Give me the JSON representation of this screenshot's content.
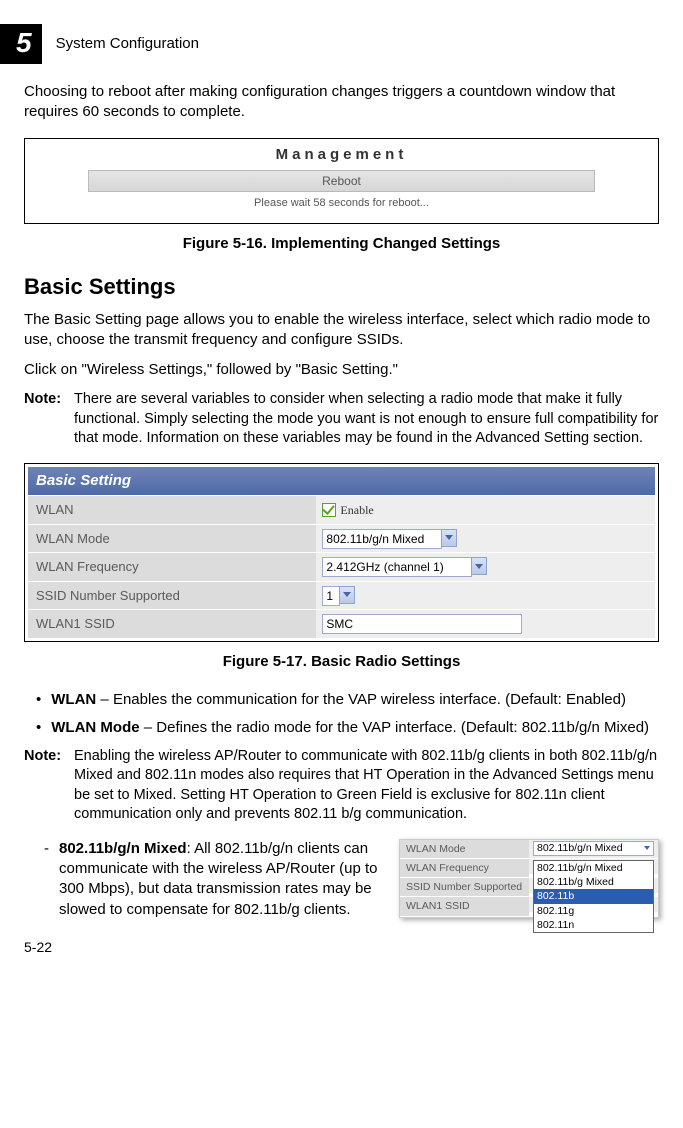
{
  "header": {
    "chapter_number": "5",
    "chapter_title": "System Configuration"
  },
  "para_intro": "Choosing to reboot after making configuration changes triggers a countdown window that requires 60 seconds to complete.",
  "fig516": {
    "management": "Management",
    "reboot": "Reboot",
    "msg": "Please wait 58 seconds for reboot...",
    "caption": "Figure 5-16.   Implementing Changed Settings"
  },
  "h2_basic": "Basic Settings",
  "para_basic1": "The Basic Setting page allows you to enable the wireless interface, select which radio mode to use, choose the transmit frequency and configure SSIDs.",
  "para_basic2": "Click on \"Wireless Settings,\" followed by \"Basic Setting.\"",
  "note1": {
    "label": "Note:",
    "text": "There are several variables to consider when selecting a radio mode that make it fully functional. Simply selecting the mode you want is not enough to ensure full compatibility for that mode. Information on these variables may be found in the Advanced Setting section."
  },
  "fig517": {
    "title": "Basic Setting",
    "rows": {
      "wlan_l": "WLAN",
      "wlan_v": "Enable",
      "mode_l": "WLAN Mode",
      "mode_v": "802.11b/g/n Mixed",
      "freq_l": "WLAN Frequency",
      "freq_v": "2.412GHz (channel 1)",
      "ssidnum_l": "SSID Number Supported",
      "ssidnum_v": "1",
      "ssid_l": "WLAN1 SSID",
      "ssid_v": "SMC"
    },
    "caption": "Figure 5-17.   Basic Radio Settings"
  },
  "bullets": {
    "wlan_term": "WLAN",
    "wlan_text": " – Enables the communication for the VAP wireless interface. (Default: Enabled)",
    "mode_term": "WLAN Mode",
    "mode_text": " – Defines the radio mode for the VAP interface. (Default: 802.11b/g/n Mixed)"
  },
  "note2": {
    "label": "Note:",
    "text": "Enabling the wireless AP/Router to communicate with 802.11b/g clients in both 802.11b/g/n Mixed and 802.11n modes also requires that HT Operation in the Advanced Settings menu be set to Mixed. Setting HT Operation to Green Field is exclusive for 802.11n client communication only and prevents 802.11 b/g communication."
  },
  "dash": {
    "term": "802.11b/g/n Mixed",
    "text": ": All 802.11b/g/n clients can communicate with the wireless AP/Router (up to 300 Mbps), but data transmission rates may be slowed to compensate for 802.11b/g clients."
  },
  "dd_fig": {
    "mode_l": "WLAN Mode",
    "mode_v": "802.11b/g/n Mixed",
    "freq_l": "WLAN Frequency",
    "ssidnum_l": "SSID Number Supported",
    "ssid_l": "WLAN1 SSID",
    "options": {
      "o1": "802.11b/g/n Mixed",
      "o2": "802.11b/g Mixed",
      "o3": "802.11b",
      "o4": "802.11g",
      "o5": "802.11n"
    }
  },
  "page_num": "5-22"
}
